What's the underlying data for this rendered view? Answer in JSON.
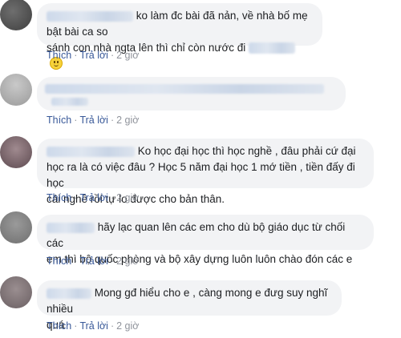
{
  "actions": {
    "like": "Thích",
    "reply": "Trả lời",
    "separator": "·"
  },
  "comments": [
    {
      "text_a": "ko làm đc bài đã nản, về nhà bố mẹ bật bài ca so",
      "text_b": "sánh con nhà ngta lên thì chỉ còn nước đi",
      "emoji": "smiling-face",
      "time": "2 giờ"
    },
    {
      "time": "2 giờ"
    },
    {
      "text_a": "Ko học đại học thì học nghề , đâu phải cứ đại",
      "text_b": "học ra là có việc đâu ? Học 5 năm đại học 1 mớ tiền , tiền đấy đi học",
      "text_c": "cái nghề rồi tự lo được cho bản thân.",
      "time": "2 giờ"
    },
    {
      "text_a": "hãy lạc quan lên các em cho dù bộ giáo dục từ chối các",
      "text_b": "em thì bộ quốc phòng và bộ xây dựng luôn luôn chào đón các e",
      "time": "2 giờ"
    },
    {
      "text_a": "Mong gđ hiểu cho e , càng mong e đưg suy nghĩ nhiều",
      "text_b": "quá",
      "time": "2 giờ"
    }
  ]
}
